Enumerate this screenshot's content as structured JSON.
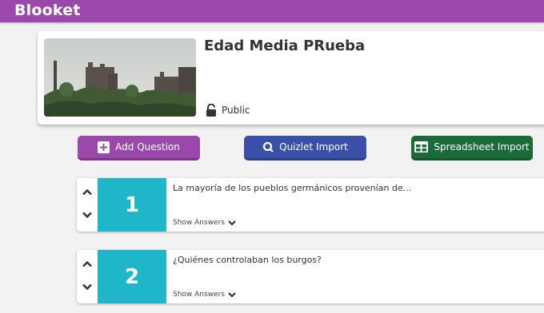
{
  "header": {
    "logo": "Blooket",
    "color": "#9a49aa"
  },
  "set": {
    "title": "Edad Media PRueba",
    "privacy": "Public",
    "cover_icon": "castle-landscape-image"
  },
  "actions": {
    "add_question": "Add Question",
    "quizlet_import": "Quizlet Import",
    "spreadsheet_import": "Spreadsheet Import"
  },
  "questions": [
    {
      "number": "1",
      "text": "La mayoría de los pueblos germánicos provenían de...",
      "show_answers": "Show Answers"
    },
    {
      "number": "2",
      "text": "¿Quiénes controlaban los burgos?",
      "show_answers": "Show Answers"
    }
  ],
  "colors": {
    "purple": "#9a49aa",
    "blue": "#3a4fa8",
    "green": "#1a6b38",
    "teal": "#1fb6c9"
  }
}
